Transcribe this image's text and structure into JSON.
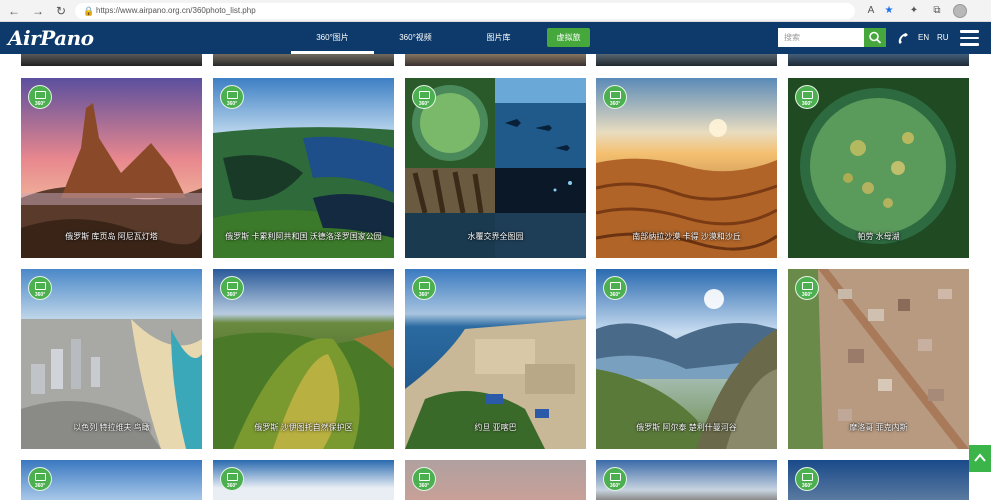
{
  "browser": {
    "url": "https://www.airpano.org.cn/360photo_list.php",
    "icons": [
      "back-icon",
      "forward-icon",
      "refresh-icon",
      "lock-icon",
      "read-aloud-icon",
      "favorite-star-icon",
      "extensions-icon",
      "collections-icon",
      "tabs-icon",
      "profile-avatar"
    ]
  },
  "header": {
    "logo": "AirPano",
    "nav": [
      {
        "label": "360°图片",
        "active": true
      },
      {
        "label": "360°视频",
        "active": false
      },
      {
        "label": "图片库",
        "active": false
      }
    ],
    "vr_button": "虚拟旅",
    "search": {
      "placeholder": "搜索",
      "value": ""
    },
    "languages": [
      "EN",
      "RU"
    ],
    "colors": {
      "header_bg": "#0d3a6b",
      "accent": "#46a83c"
    }
  },
  "badge_text": "360°",
  "cards_row1": [
    {
      "caption": "俄罗斯 库页岛 阿尼瓦灯塔"
    },
    {
      "caption": "俄罗斯 卡累利阿共和国 沃德洛泽罗国家公园"
    },
    {
      "caption": "水覆交界全图园"
    },
    {
      "caption": "南部纳拉沙漠 卡得 沙漠和沙丘"
    },
    {
      "caption": "帕劳 水母湖"
    }
  ],
  "cards_row2": [
    {
      "caption": "以色列 特拉维夫 鸟瞰"
    },
    {
      "caption": "俄罗斯 沙伊图托自然保护区"
    },
    {
      "caption": "约旦 亚喀巴"
    },
    {
      "caption": "俄罗斯 阿尔泰 楚利什曼河谷"
    },
    {
      "caption": "摩洛哥 菲克内斯"
    }
  ]
}
